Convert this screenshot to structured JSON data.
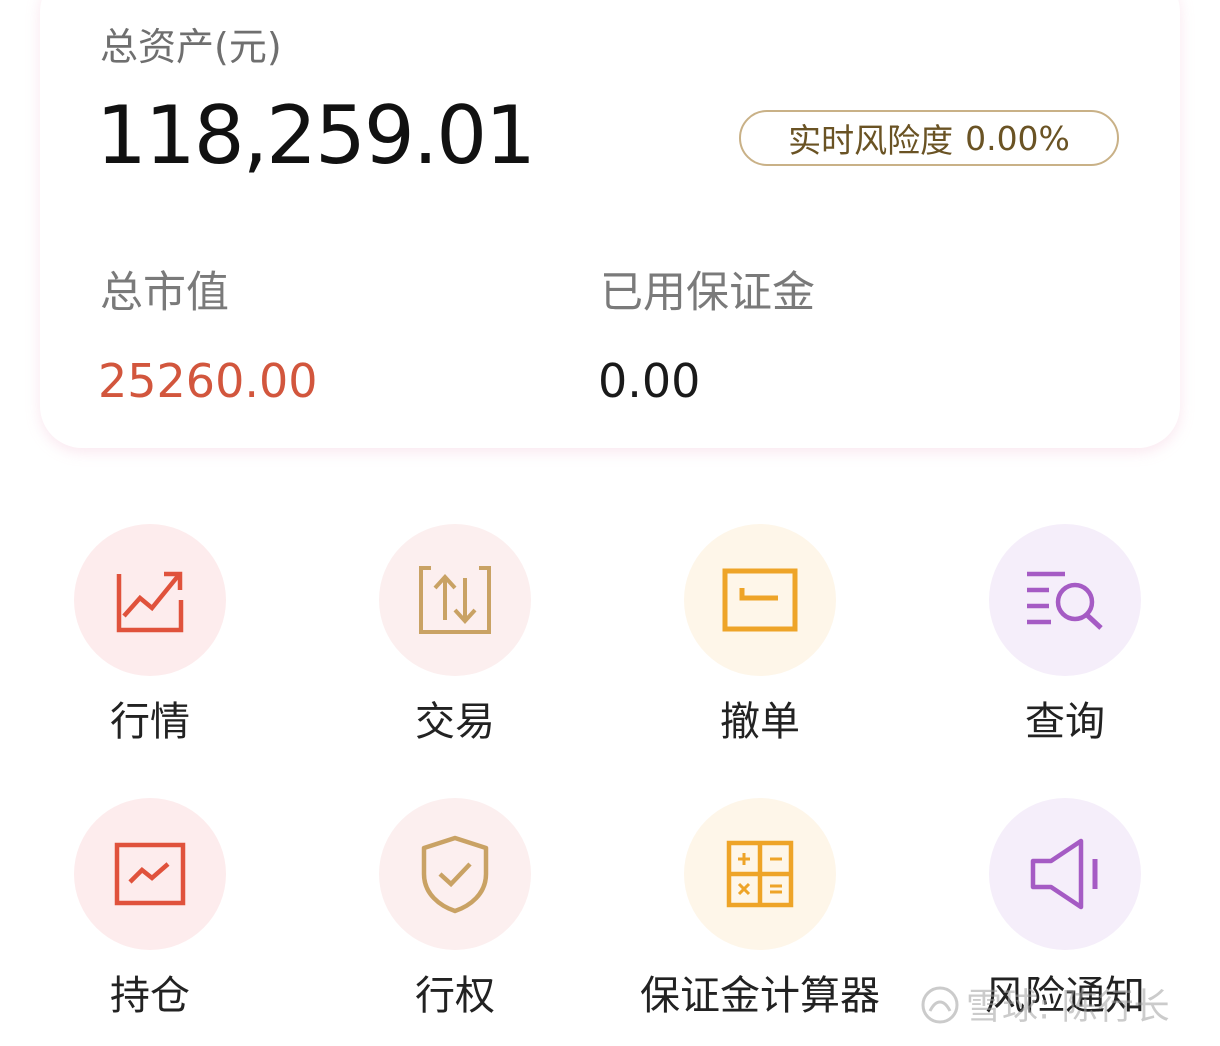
{
  "summary": {
    "total_assets_label": "总资产(元)",
    "total_assets_value": "118,259.01",
    "risk_label": "实时风险度",
    "risk_value": "0.00%",
    "market_value_label": "总市值",
    "market_value": "25260.00",
    "margin_used_label": "已用保证金",
    "margin_used_value": "0.00"
  },
  "menu": [
    {
      "label": "行情",
      "icon": "chart-trend-icon",
      "color": "#e0523c"
    },
    {
      "label": "交易",
      "icon": "exchange-arrows-icon",
      "color": "#c9a264"
    },
    {
      "label": "撤单",
      "icon": "cancel-order-icon",
      "color": "#eea428"
    },
    {
      "label": "查询",
      "icon": "search-list-icon",
      "color": "#a55bc4"
    },
    {
      "label": "持仓",
      "icon": "position-chart-icon",
      "color": "#e0523c"
    },
    {
      "label": "行权",
      "icon": "shield-check-icon",
      "color": "#c9a264"
    },
    {
      "label": "保证金计算器",
      "icon": "calculator-icon",
      "color": "#eea428"
    },
    {
      "label": "风险通知",
      "icon": "speaker-icon",
      "color": "#a55bc4"
    }
  ],
  "watermark": {
    "text": "雪球: 陈行长"
  }
}
